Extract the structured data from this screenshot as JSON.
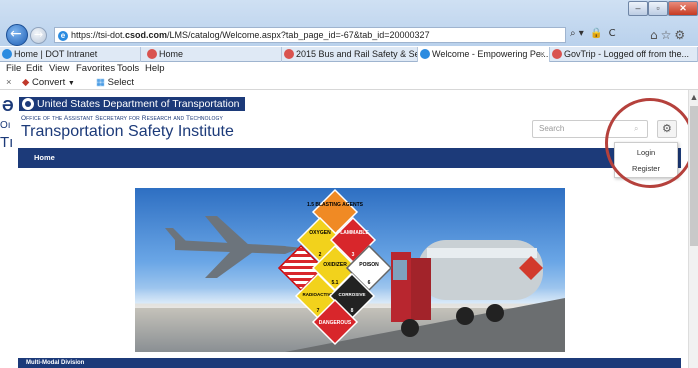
{
  "browser": {
    "url_prefix": "https://tsi-dot.",
    "url_domain": "csod.com",
    "url_suffix": "/LMS/catalog/Welcome.aspx?tab_page_id=-67&tab_id=20000327",
    "tools": [
      "⌕ ▾",
      "🔒",
      "C"
    ],
    "tabs": [
      {
        "label": "Home | DOT Intranet",
        "icon_color": "#2b8be0"
      },
      {
        "label": "Home",
        "icon_color": "#d9534f"
      },
      {
        "label": "2015 Bus and Rail Safety & Sec...",
        "icon_color": "#d9534f"
      },
      {
        "label": "Welcome - Empowering Pe...",
        "icon_color": "#2b8be0",
        "active": true
      },
      {
        "label": "GovTrip - Logged off from the...",
        "icon_color": "#d9534f"
      }
    ],
    "tab_close": "×",
    "menu": [
      "File",
      "Edit",
      "View",
      "Favorites",
      "Tools",
      "Help"
    ],
    "command_bar": {
      "close": "×",
      "convert": "Convert",
      "select": "Select"
    }
  },
  "page": {
    "agency": "United States Department of Transportation",
    "office": "Office of the Assistant Secretary for Research and Technology",
    "title": "Transportation Safety Institute",
    "search_placeholder": "Search",
    "nav": {
      "home": "Home"
    },
    "user_menu": {
      "login": "Login",
      "register": "Register"
    },
    "section_title": "Multi-Modal Division",
    "hazmat": {
      "labels": [
        "1.5 BLASTING AGENTS",
        "OXYGEN",
        "FLAMMABLE",
        "OXIDIZER",
        "POISON",
        "RADIOACTIVE",
        "CORROSIVE",
        "DANGEROUS"
      ],
      "numbers": [
        "2",
        "3",
        "5.1",
        "6",
        "7",
        "8"
      ]
    }
  },
  "ghost": {
    "a": "Ә",
    "b": "Oı",
    "c": "Tı"
  },
  "colors": {
    "dot_blue": "#1c3a79",
    "highlight_circle": "#b5413c"
  }
}
